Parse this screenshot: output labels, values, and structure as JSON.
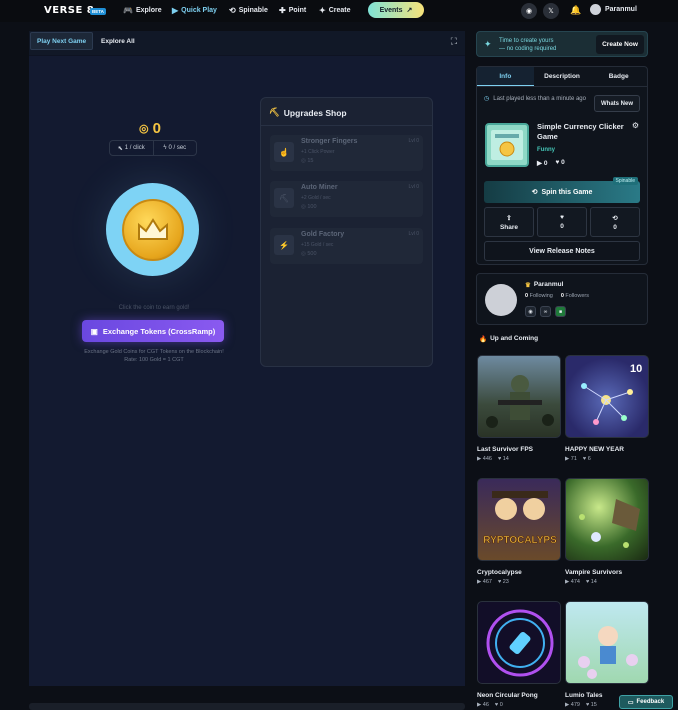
{
  "topbar": {
    "logo": "VERSE 8",
    "beta": "BETA",
    "nav": [
      {
        "label": "Explore",
        "icon": "gamepad-icon"
      },
      {
        "label": "Quick Play",
        "icon": "play-icon"
      },
      {
        "label": "Spinable",
        "icon": "spin-icon"
      },
      {
        "label": "Point",
        "icon": "point-icon"
      },
      {
        "label": "Create",
        "icon": "sparkle-icon"
      }
    ],
    "events_label": "Events",
    "username": "Paranmul"
  },
  "game": {
    "tabs": {
      "play_next": "Play Next Game",
      "explore_all": "Explore All"
    },
    "coin_count": "0",
    "per_click": "1 / click",
    "per_sec": "0 / sec",
    "hint": "Click the coin to earn gold!",
    "exchange_label": "Exchange Tokens (CrossRamp)",
    "exchange_note_1": "Exchange Gold Coins for CGT Tokens on the Blockchain!",
    "exchange_note_2": "Rate: 100 Gold = 1 CGT",
    "shop": {
      "title": "Upgrades Shop",
      "items": [
        {
          "name": "Stronger Fingers",
          "desc": "+1 Click Power",
          "price": "15",
          "level": "Lvl 0"
        },
        {
          "name": "Auto Miner",
          "desc": "+2 Gold / sec",
          "price": "100",
          "level": "Lvl 0"
        },
        {
          "name": "Gold Factory",
          "desc": "+15 Gold / sec",
          "price": "500",
          "level": "Lvl 0"
        }
      ]
    }
  },
  "sidebar": {
    "create": {
      "line1": "Time to create yours",
      "line2": "— no coding required",
      "button": "Create Now"
    },
    "info_tabs": [
      "Info",
      "Description",
      "Badge"
    ],
    "last_played": "Last played less than a minute ago",
    "whats_new": "Whats New",
    "game_title": "Simple Currency Clicker Game",
    "genre": "Funny",
    "plays": "0",
    "likes": "0",
    "spin_label": "Spin this Game",
    "spinable_tag": "Spinable",
    "actions": {
      "share": "Share",
      "likes": "0",
      "remixes": "0"
    },
    "release_notes": "View Release Notes",
    "creator": {
      "name": "Paranmul",
      "following_count": "0",
      "following_label": "Following",
      "followers_count": "0",
      "followers_label": "Followers"
    },
    "upcoming_title": "Up and Coming",
    "games": [
      {
        "title": "Last Survivor FPS",
        "plays": "446",
        "likes": "14",
        "badge": ""
      },
      {
        "title": "HAPPY NEW YEAR",
        "plays": "71",
        "likes": "6",
        "badge": "10"
      },
      {
        "title": "Cryptocalypse",
        "plays": "467",
        "likes": "23",
        "badge": "RYPTOCALYPS"
      },
      {
        "title": "Vampire Survivors",
        "plays": "474",
        "likes": "14",
        "badge": ""
      },
      {
        "title": "Neon Circular Pong",
        "plays": "46",
        "likes": "0",
        "badge": ""
      },
      {
        "title": "Lumio Tales",
        "plays": "479",
        "likes": "15",
        "badge": ""
      }
    ]
  },
  "feedback_label": "Feedback",
  "colors": {
    "accent": "#7ed0f0",
    "coin": "#f5c542",
    "exchange": "#7a52ea",
    "teal": "#44c6b7"
  }
}
